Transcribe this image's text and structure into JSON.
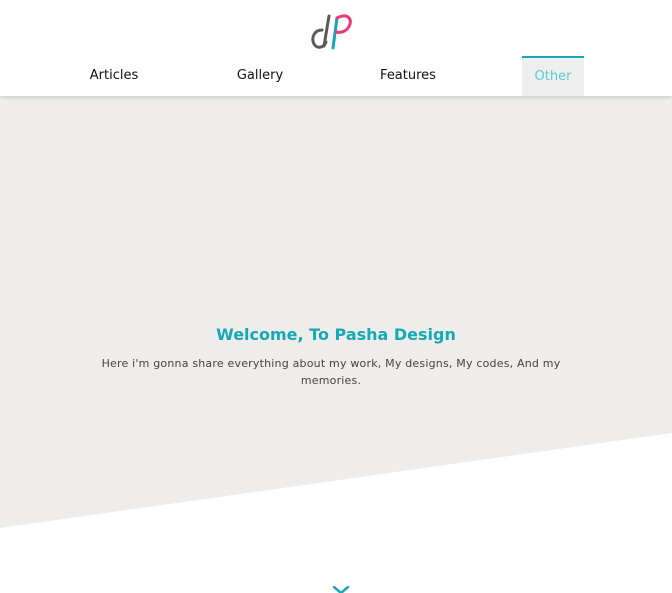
{
  "brand": {
    "logo_name": "dp-logo",
    "colors": {
      "accent": "#17a8b5",
      "pink": "#e63b78",
      "grey": "#5a5a5a"
    }
  },
  "nav": {
    "items": [
      {
        "label": "Articles",
        "active": false
      },
      {
        "label": "Gallery",
        "active": false
      },
      {
        "label": "Features",
        "active": false
      },
      {
        "label": "Other",
        "active": true
      }
    ]
  },
  "hero": {
    "title": "Welcome, To Pasha Design",
    "text": "Here i'm gonna share everything about my work, My designs, My codes, And my memories.",
    "background": "#eeedeb"
  },
  "scroll": {
    "icon": "chevron-down-icon"
  }
}
